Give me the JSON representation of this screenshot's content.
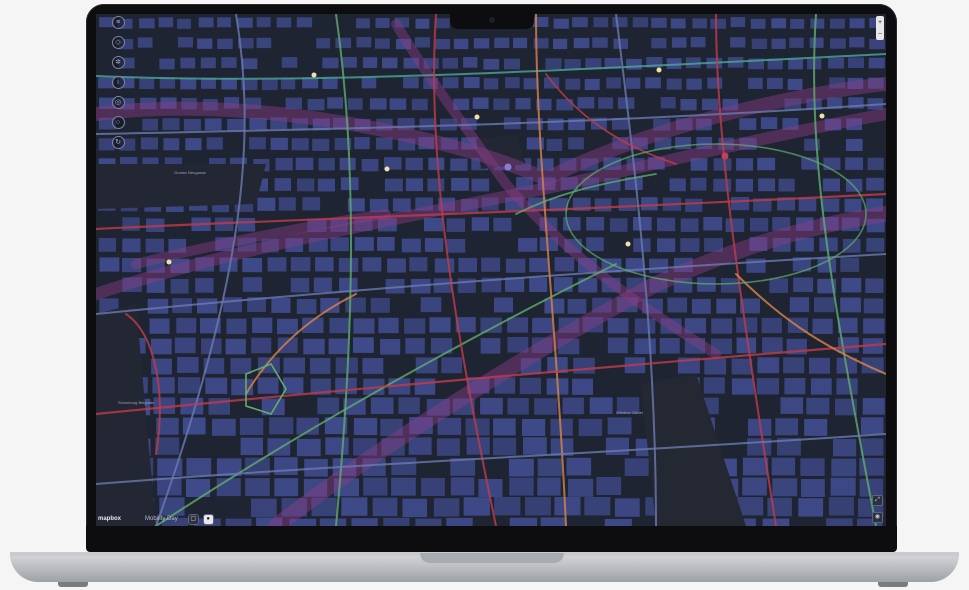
{
  "map": {
    "brand": "mapbox",
    "view_label": "Mobility Day",
    "street_labels": [
      "Grosse Neugasse",
      "Schonburg Belgrade",
      "Wiedner Gürtel"
    ],
    "pois": [
      {
        "type": "point-of-interest"
      },
      {
        "type": "point-of-interest"
      },
      {
        "type": "point-of-interest"
      },
      {
        "type": "point-of-interest"
      },
      {
        "type": "point-of-interest"
      },
      {
        "type": "point-of-interest"
      },
      {
        "type": "transit"
      },
      {
        "type": "transit-red"
      }
    ]
  },
  "toolbar": {
    "tools": [
      {
        "icon": "layers-icon"
      },
      {
        "icon": "compass-icon"
      },
      {
        "icon": "settings-icon"
      },
      {
        "icon": "info-icon"
      },
      {
        "icon": "location-icon"
      },
      {
        "icon": "search-icon"
      },
      {
        "icon": "share-icon"
      }
    ]
  },
  "right_controls": {
    "zoom_in": "+",
    "zoom_out": "−"
  },
  "colors": {
    "background": "#1c2230",
    "block": "#3f4a8a",
    "road_red": "#c23b4a",
    "road_green": "#5fae6e",
    "road_orange": "#d8844a",
    "corridor_purple": "#7a3a7e",
    "poi": "#f1e3a8"
  }
}
